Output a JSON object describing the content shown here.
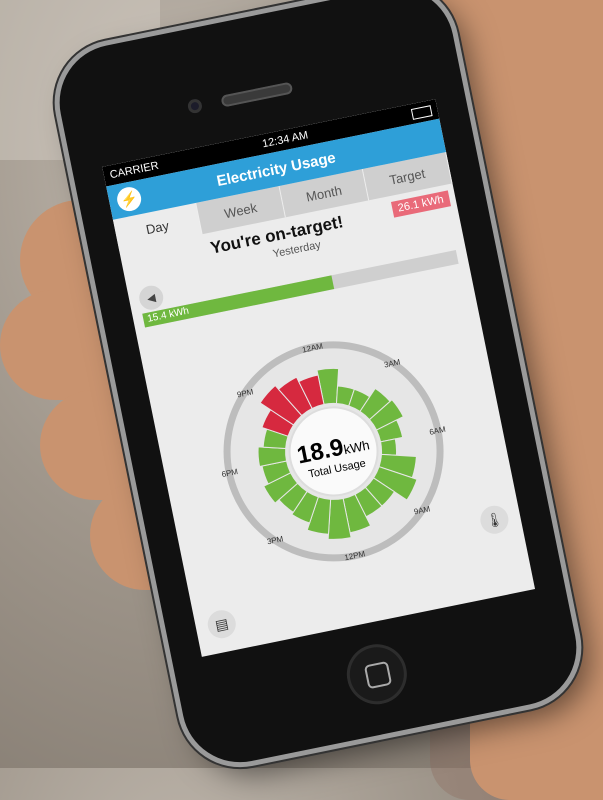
{
  "status_bar": {
    "carrier": "CARRIER",
    "time": "12:34 AM"
  },
  "nav": {
    "title": "Electricity Usage",
    "menu_icon": "bolt-icon"
  },
  "tabs": [
    {
      "label": "Day",
      "active": true
    },
    {
      "label": "Week",
      "active": false
    },
    {
      "label": "Month",
      "active": false
    },
    {
      "label": "Target",
      "active": false
    }
  ],
  "summary": {
    "headline": "You're on-target!",
    "period": "Yesterday",
    "target_label": "26.1 kWh",
    "actual_label": "15.4 kWh",
    "actual_fraction": 0.59
  },
  "dial": {
    "value": "18.9",
    "unit": "kWh",
    "label": "Total Usage",
    "time_labels": [
      "12AM",
      "3AM",
      "6AM",
      "9AM",
      "12PM",
      "3PM",
      "6PM",
      "9PM"
    ]
  },
  "icons": {
    "left": "router-icon",
    "right": "thermometer-icon"
  },
  "colors": {
    "accent": "#2e9fd8",
    "good": "#6fb83f",
    "over": "#d6293f",
    "target": "#e96a79"
  },
  "chart_data": {
    "type": "radial-bar",
    "hours": [
      0,
      1,
      2,
      3,
      4,
      5,
      6,
      7,
      8,
      9,
      10,
      11,
      12,
      13,
      14,
      15,
      16,
      17,
      18,
      19,
      20,
      21,
      22,
      23
    ],
    "values": [
      0.7,
      0.35,
      0.35,
      0.55,
      0.6,
      0.45,
      0.3,
      0.7,
      0.8,
      0.5,
      0.5,
      0.7,
      0.8,
      0.7,
      0.55,
      0.5,
      0.6,
      0.5,
      0.55,
      0.45,
      0.55,
      0.8,
      0.7,
      0.6
    ],
    "over_target_hours": [
      20,
      21,
      22,
      23
    ]
  }
}
